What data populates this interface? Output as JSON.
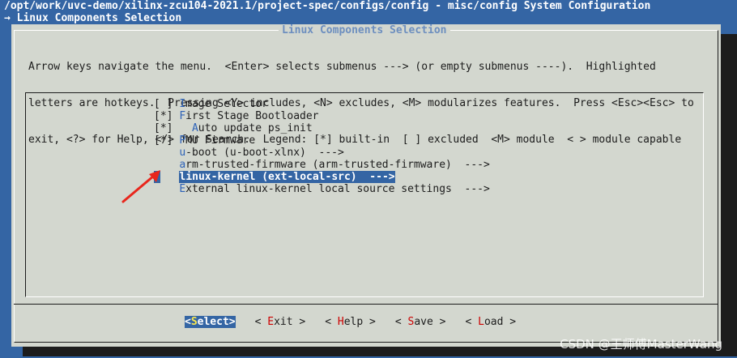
{
  "header": {
    "path": "/opt/work/uvc-demo/xilinx-zcu104-2021.1/project-spec/configs/config - misc/config System Configuration",
    "breadcrumb": "→ Linux Components Selection"
  },
  "dialog": {
    "title": "Linux Components Selection",
    "help_lines": [
      "Arrow keys navigate the menu.  <Enter> selects submenus ---> (or empty submenus ----).  Highlighted",
      "letters are hotkeys.  Pressing <Y> includes, <N> excludes, <M> modularizes features.  Press <Esc><Esc> to",
      "exit, <?> for Help, </> for Search.  Legend: [*] built-in  [ ] excluded  <M> module  < > module capable"
    ]
  },
  "menu": {
    "items": [
      {
        "prefix": "[ ] ",
        "hotkey": "I",
        "rest": "mage Selector"
      },
      {
        "prefix": "[*] ",
        "hotkey": "F",
        "rest": "irst Stage Bootloader"
      },
      {
        "prefix": "[*]   ",
        "hotkey": "A",
        "rest": "uto update ps_init"
      },
      {
        "prefix": "[*] ",
        "hotkey": "P",
        "rest": "MU Firmware"
      },
      {
        "prefix": "    ",
        "hotkey": "u",
        "rest": "-boot (u-boot-xlnx)  --->"
      },
      {
        "prefix": "    ",
        "hotkey": "a",
        "rest": "rm-trusted-firmware (arm-trusted-firmware)  --->"
      },
      {
        "prefix": "    ",
        "hotkey": "l",
        "rest": "inux-kernel (ext-local-src)  --->",
        "selected": true
      },
      {
        "prefix": "    ",
        "hotkey": "E",
        "rest": "xternal linux-kernel local source settings  --->"
      }
    ]
  },
  "buttons": [
    {
      "open": "<",
      "hotkey": "S",
      "rest": "elect",
      "close": ">",
      "active": true
    },
    {
      "open": "< ",
      "hotkey": "E",
      "rest": "xit",
      "close": " >"
    },
    {
      "open": "< ",
      "hotkey": "H",
      "rest": "elp",
      "close": " >"
    },
    {
      "open": "< ",
      "hotkey": "S",
      "rest": "ave",
      "close": " >"
    },
    {
      "open": "< ",
      "hotkey": "L",
      "rest": "oad",
      "close": " >"
    }
  ],
  "watermark": "CSDN @王师傅MasterWang",
  "colors": {
    "background": "#3465a4",
    "dialog": "#d3d7cf",
    "highlight": "#3465a4",
    "hotkey": "#2e63b8",
    "annotation_arrow": "#e8261c"
  }
}
